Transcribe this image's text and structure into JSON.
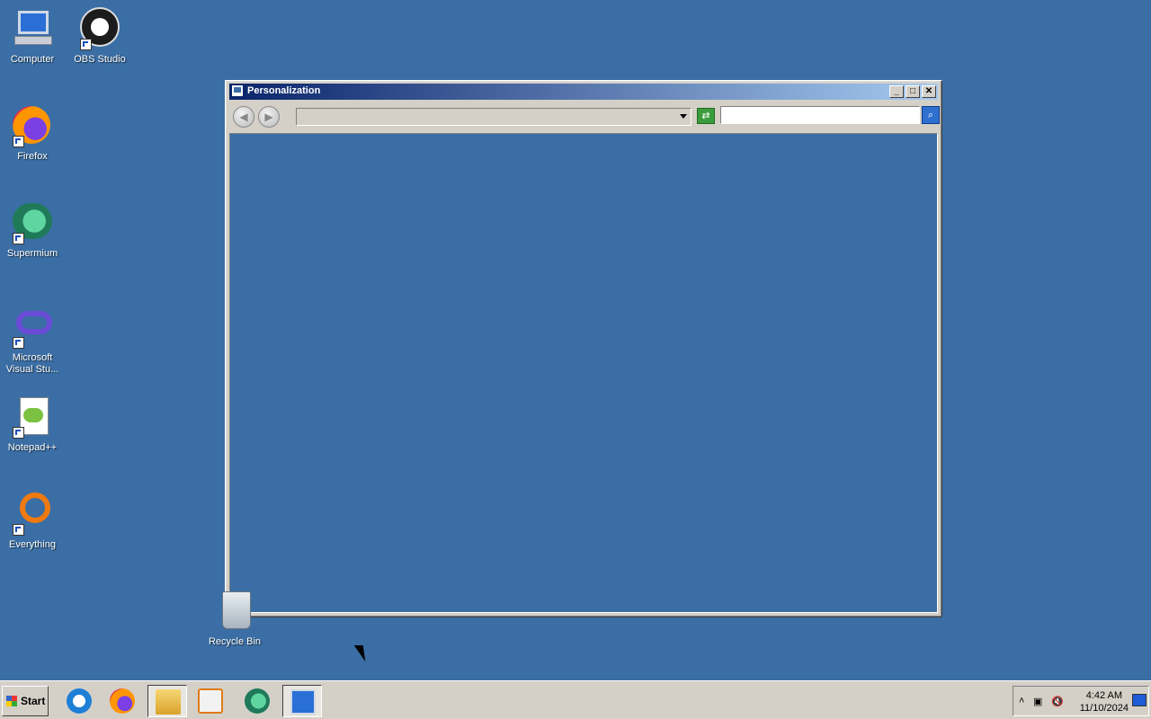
{
  "desktop": {
    "icons": [
      {
        "label": "Computer"
      },
      {
        "label": "OBS Studio"
      },
      {
        "label": "Firefox"
      },
      {
        "label": "Supermium"
      },
      {
        "label": "Microsoft Visual Stu..."
      },
      {
        "label": "Notepad++"
      },
      {
        "label": "Everything"
      },
      {
        "label": "Recycle Bin"
      }
    ]
  },
  "window": {
    "title": "Personalization",
    "address": "",
    "search_value": "",
    "controls": {
      "minimize": "_",
      "maximize": "□",
      "close": "✕"
    }
  },
  "taskbar": {
    "start_label": "Start",
    "items": [
      "internet-explorer-icon",
      "firefox-icon",
      "file-explorer-icon",
      "media-player-icon",
      "supermium-icon",
      "control-panel-icon"
    ],
    "tray": {
      "time": "4:42 AM",
      "date": "11/10/2024"
    }
  },
  "colors": {
    "desktop": "#3a6ea5",
    "title_start": "#0a246a",
    "title_end": "#a6caf0",
    "chrome": "#d4d0c8"
  }
}
